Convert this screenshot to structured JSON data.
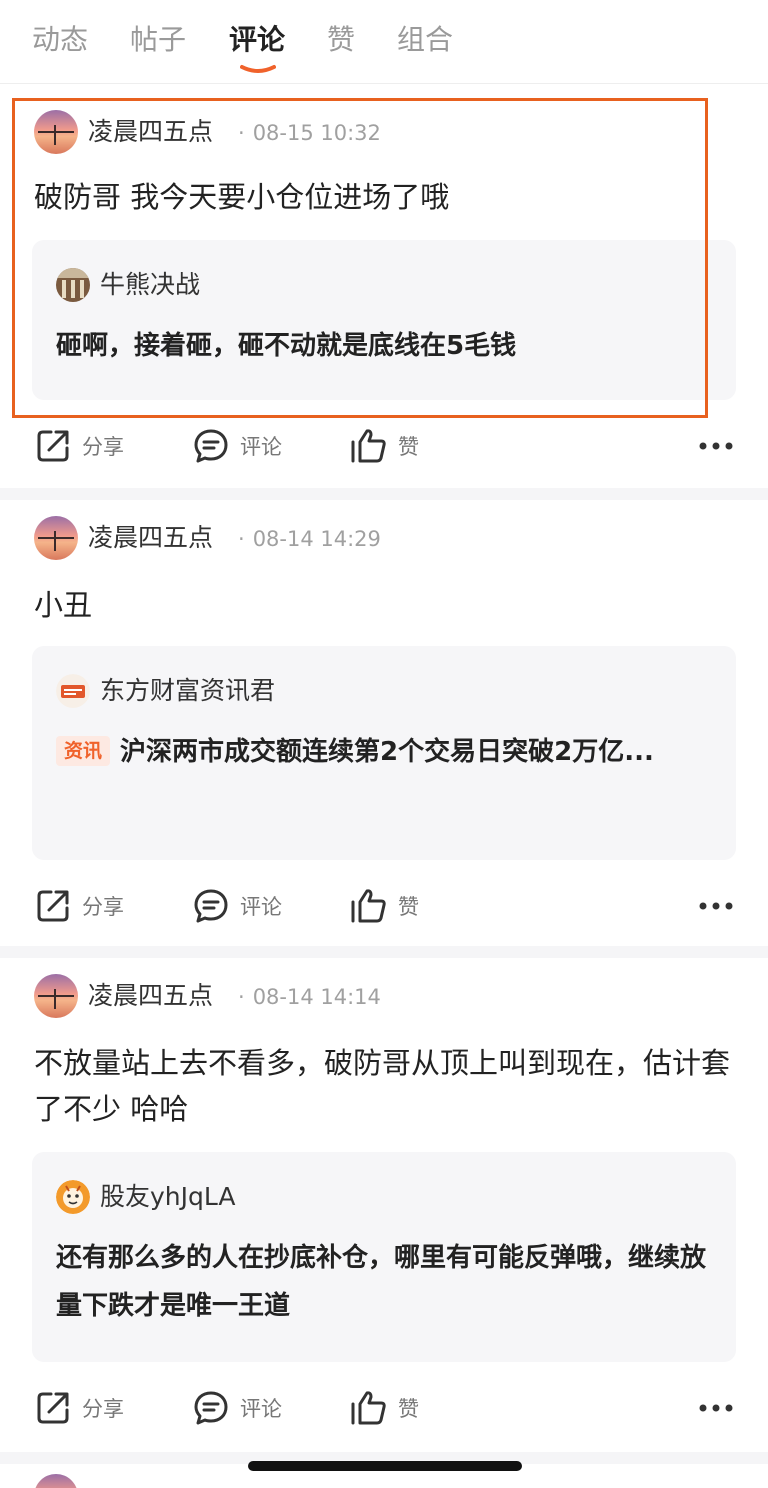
{
  "tabs": [
    {
      "label": "动态",
      "active": false
    },
    {
      "label": "帖子",
      "active": false
    },
    {
      "label": "评论",
      "active": true
    },
    {
      "label": "赞",
      "active": false
    },
    {
      "label": "组合",
      "active": false
    }
  ],
  "colors": {
    "accent": "#f0622b",
    "highlight_border": "#e8611f"
  },
  "posts": [
    {
      "username": "凌晨四五点",
      "time": "08-15 10:32",
      "content": "破防哥 我今天要小仓位进场了哦",
      "quote": {
        "avatar_icon": "bull-bear-avatar",
        "author": "牛熊决战",
        "text": "砸啊，接着砸，砸不动就是底线在5毛钱"
      },
      "actions": {
        "share": "分享",
        "comment": "评论",
        "like": "赞"
      }
    },
    {
      "username": "凌晨四五点",
      "time": "08-14 14:29",
      "content": "小丑",
      "quote": {
        "avatar_icon": "news-avatar",
        "author": "东方财富资讯君",
        "badge": "资讯",
        "text": "沪深两市成交额连续第2个交易日突破2万亿..."
      },
      "actions": {
        "share": "分享",
        "comment": "评论",
        "like": "赞"
      }
    },
    {
      "username": "凌晨四五点",
      "time": "08-14 14:14",
      "content": "不放量站上去不看多，破防哥从顶上叫到现在，估计套了不少 哈哈",
      "quote": {
        "avatar_icon": "tiger-avatar",
        "author": "股友yhJqLA",
        "text": "还有那么多的人在抄底补仓，哪里有可能反弹哦，继续放量下跌才是唯一王道"
      },
      "actions": {
        "share": "分享",
        "comment": "评论",
        "like": "赞"
      }
    }
  ],
  "icons": {
    "share": "share-icon",
    "comment": "comment-icon",
    "like": "thumbs-up-icon",
    "more": "more-icon"
  }
}
